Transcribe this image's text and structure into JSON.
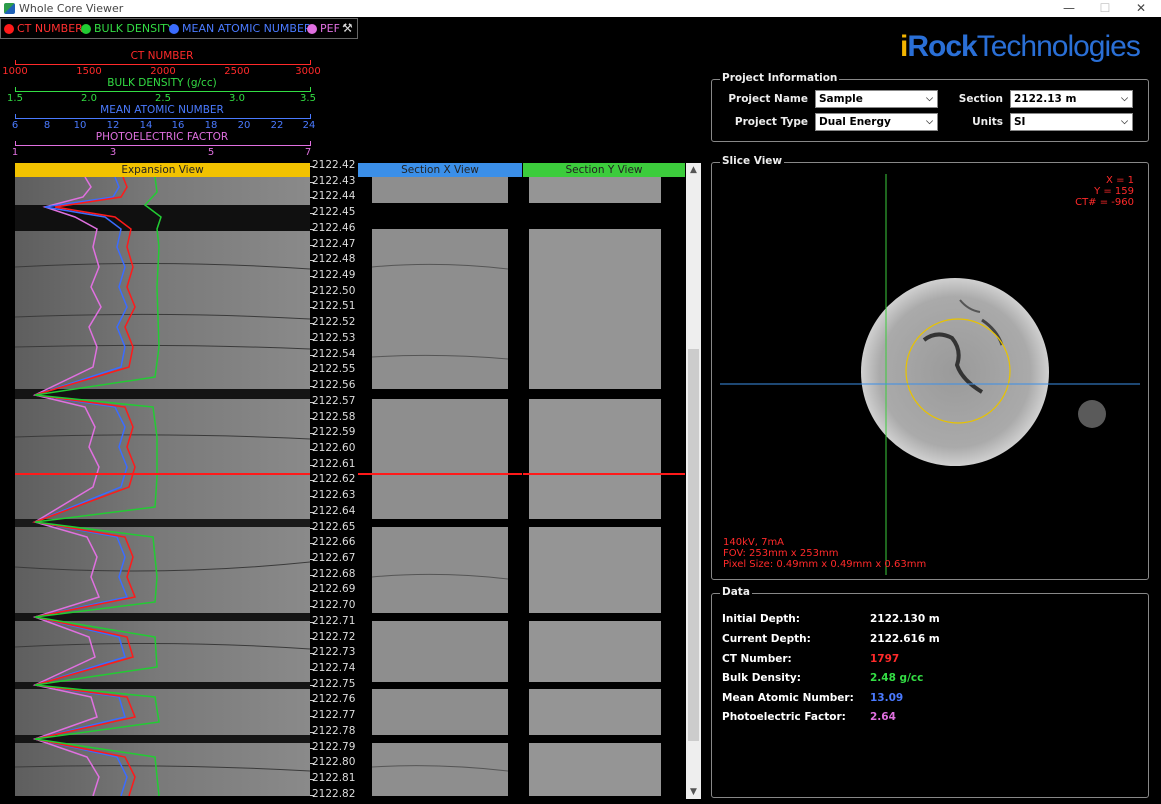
{
  "window": {
    "title": "Whole Core Viewer",
    "min": "—",
    "max": "☐",
    "close": "✕"
  },
  "legend": [
    {
      "label": "CT NUMBER",
      "color": "#ff1a1a"
    },
    {
      "label": "BULK DENSITY",
      "color": "#22cc33"
    },
    {
      "label": "MEAN ATOMIC NUMBER",
      "color": "#3b6cff"
    },
    {
      "label": "PEF",
      "color": "#e070e0"
    }
  ],
  "scales": [
    {
      "title": "CT NUMBER",
      "color": "#ff2a2a",
      "ticks": [
        "1000",
        "1500",
        "2000",
        "2500",
        "3000"
      ]
    },
    {
      "title": "BULK DENSITY (g/cc)",
      "color": "#33dd44",
      "ticks": [
        "1.5",
        "2.0",
        "2.5",
        "3.0",
        "3.5"
      ]
    },
    {
      "title": "MEAN ATOMIC NUMBER",
      "color": "#4a7aff",
      "ticks": [
        "6",
        "8",
        "10",
        "12",
        "14",
        "16",
        "18",
        "20",
        "22",
        "24"
      ]
    },
    {
      "title": "PHOTOELECTRIC FACTOR",
      "color": "#e070e0",
      "ticks": [
        "1",
        "3",
        "5",
        "7"
      ]
    }
  ],
  "views": {
    "expansion": "Expansion View",
    "section_x": "Section X View",
    "section_y": "Section Y View"
  },
  "depths": [
    "2122.42",
    "2122.43",
    "2122.44",
    "2122.45",
    "2122.46",
    "2122.47",
    "2122.48",
    "2122.49",
    "2122.50",
    "2122.51",
    "2122.52",
    "2122.53",
    "2122.54",
    "2122.55",
    "2122.56",
    "2122.57",
    "2122.58",
    "2122.59",
    "2122.60",
    "2122.61",
    "2122.62",
    "2122.63",
    "2122.64",
    "2122.65",
    "2122.66",
    "2122.67",
    "2122.68",
    "2122.69",
    "2122.70",
    "2122.71",
    "2122.72",
    "2122.73",
    "2122.74",
    "2122.75",
    "2122.76",
    "2122.77",
    "2122.78",
    "2122.79",
    "2122.80",
    "2122.81",
    "2122.82"
  ],
  "logo": {
    "i": "i",
    "rock": "Rock",
    "tech": "Technologies"
  },
  "project": {
    "title": "Project Information",
    "name_label": "Project Name",
    "name_value": "Sample",
    "type_label": "Project Type",
    "type_value": "Dual Energy",
    "section_label": "Section",
    "section_value": "2122.13 m",
    "units_label": "Units",
    "units_value": "SI"
  },
  "slice": {
    "title": "Slice View",
    "x": "X = 1",
    "y": "Y = 159",
    "ct": "CT# = -960",
    "kv": "140kV, 7mA",
    "fov": "FOV: 253mm x 253mm",
    "pixel": "Pixel Size: 0.49mm x 0.49mm x 0.63mm"
  },
  "data": {
    "title": "Data",
    "rows": [
      {
        "label": "Initial Depth:",
        "value": "2122.130 m",
        "color": "#ffffff"
      },
      {
        "label": "Current Depth:",
        "value": "2122.616 m",
        "color": "#ffffff"
      },
      {
        "label": "CT Number:",
        "value": "1797",
        "color": "#ff2a2a"
      },
      {
        "label": "Bulk Density:",
        "value": "2.48 g/cc",
        "color": "#33dd44"
      },
      {
        "label": "Mean Atomic Number:",
        "value": "13.09",
        "color": "#4a7aff"
      },
      {
        "label": "Photoelectric Factor:",
        "value": "2.64",
        "color": "#e070e0"
      }
    ]
  }
}
